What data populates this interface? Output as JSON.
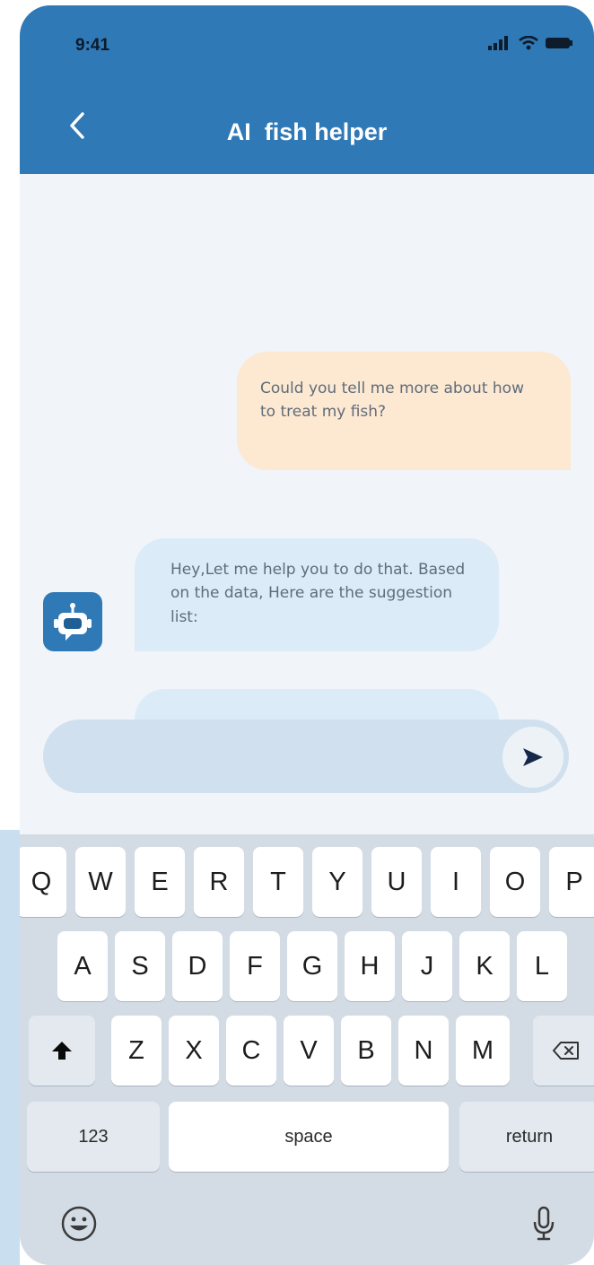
{
  "status_bar": {
    "time": "9:41"
  },
  "header": {
    "title": "AI  fish helper"
  },
  "messages": {
    "user": "Could you tell me more about how to treat my fish?",
    "bot": "Hey,Let me help you to do that. Based on the data, Here are the suggestion list:"
  },
  "composer": {
    "placeholder": ""
  },
  "keyboard": {
    "row1": [
      "Q",
      "W",
      "E",
      "R",
      "T",
      "Y",
      "U",
      "I",
      "O",
      "P"
    ],
    "row2": [
      "A",
      "S",
      "D",
      "F",
      "G",
      "H",
      "J",
      "K",
      "L"
    ],
    "row3": [
      "Z",
      "X",
      "C",
      "V",
      "B",
      "N",
      "M"
    ],
    "numbers_label": "123",
    "space_label": "space",
    "return_label": "return"
  },
  "colors": {
    "header": "#2f79b6",
    "user_bubble": "#fde8d2",
    "bot_bubble": "#dcebf8",
    "composer": "#d0e0ee",
    "keyboard": "#d3dce5"
  },
  "icons": [
    "back-chevron-icon",
    "signal-icon",
    "wifi-icon",
    "battery-icon",
    "robot-icon",
    "send-icon",
    "shift-icon",
    "backspace-icon",
    "emoji-icon",
    "microphone-icon"
  ]
}
